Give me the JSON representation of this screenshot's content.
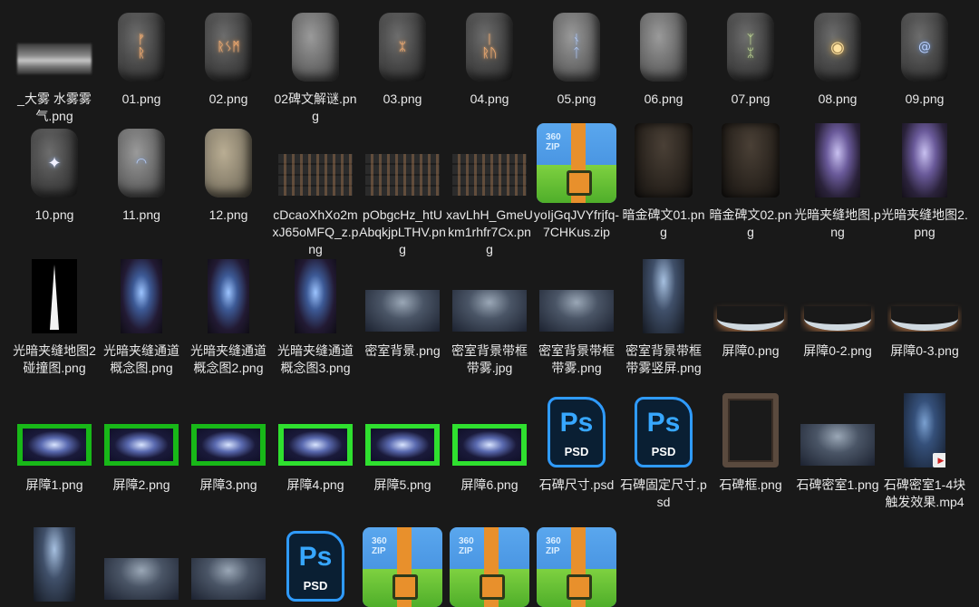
{
  "files": [
    {
      "name": "_大雾 水雾雾气.png",
      "thumb": "fog"
    },
    {
      "name": "01.png",
      "thumb": "stone",
      "glyph": "ᚠ\nᚱ",
      "tone": "orange"
    },
    {
      "name": "02.png",
      "thumb": "stone",
      "glyph": "ᚱᛊᛗ",
      "tone": "orange"
    },
    {
      "name": "02碑文解谜.png",
      "thumb": "stone-light",
      "glyph": ""
    },
    {
      "name": "03.png",
      "thumb": "stone",
      "glyph": "ᛯ",
      "tone": "orange"
    },
    {
      "name": "04.png",
      "thumb": "stone",
      "glyph": "ᛁ\nᚱᚢ",
      "tone": "orange"
    },
    {
      "name": "05.png",
      "thumb": "stone-light",
      "glyph": "ᚾ\nᛏ",
      "tone": "blue"
    },
    {
      "name": "06.png",
      "thumb": "stone-light",
      "glyph": "",
      "tone": "blue"
    },
    {
      "name": "07.png",
      "thumb": "stone",
      "glyph": "ᛉ\nᛯ",
      "tone": "green"
    },
    {
      "name": "08.png",
      "thumb": "stone",
      "glyph": "◉",
      "tone": "gold"
    },
    {
      "name": "09.png",
      "thumb": "stone",
      "glyph": "@",
      "tone": "blue"
    },
    {
      "name": "10.png",
      "thumb": "stone",
      "glyph": "✦",
      "tone": "white"
    },
    {
      "name": "11.png",
      "thumb": "stone-light",
      "glyph": "◠",
      "tone": "blue"
    },
    {
      "name": "12.png",
      "thumb": "stone-moss",
      "glyph": ""
    },
    {
      "name": "cDcaoXhXo2mxJ65oMFQ_z.png",
      "thumb": "sheet"
    },
    {
      "name": "pObgcHz_htUAbqkjpLTHV.png",
      "thumb": "sheet"
    },
    {
      "name": "xavLhH_GmeUkm1rhfr7Cx.png",
      "thumb": "sheet"
    },
    {
      "name": "yoIjGqJVYfrjfq-7CHKus.zip",
      "thumb": "zip"
    },
    {
      "name": "暗金碑文01.png",
      "thumb": "dark-tablet"
    },
    {
      "name": "暗金碑文02.png",
      "thumb": "dark-tablet"
    },
    {
      "name": "光暗夹缝地图.png",
      "thumb": "tower"
    },
    {
      "name": "光暗夹缝地图2.png",
      "thumb": "tower"
    },
    {
      "name": "光暗夹缝地图2碰撞图.png",
      "thumb": "spike"
    },
    {
      "name": "光暗夹缝通道概念图.png",
      "thumb": "concept"
    },
    {
      "name": "光暗夹缝通道概念图2.png",
      "thumb": "concept"
    },
    {
      "name": "光暗夹缝通道概念图3.png",
      "thumb": "concept"
    },
    {
      "name": "密室背景.png",
      "thumb": "room"
    },
    {
      "name": "密室背景带框带雾.jpg",
      "thumb": "room"
    },
    {
      "name": "密室背景带框带雾.png",
      "thumb": "room"
    },
    {
      "name": "密室背景带框带雾竖屏.png",
      "thumb": "room-v"
    },
    {
      "name": "屏障0.png",
      "thumb": "barrier"
    },
    {
      "name": "屏障0-2.png",
      "thumb": "barrier"
    },
    {
      "name": "屏障0-3.png",
      "thumb": "barrier"
    },
    {
      "name": "屏障1.png",
      "thumb": "green"
    },
    {
      "name": "屏障2.png",
      "thumb": "green"
    },
    {
      "name": "屏障3.png",
      "thumb": "green"
    },
    {
      "name": "屏障4.png",
      "thumb": "green-bright"
    },
    {
      "name": "屏障5.png",
      "thumb": "green-bright"
    },
    {
      "name": "屏障6.png",
      "thumb": "green-bright"
    },
    {
      "name": "石碑尺寸.psd",
      "thumb": "psd"
    },
    {
      "name": "石碑固定尺寸.psd",
      "thumb": "psd"
    },
    {
      "name": "石碑框.png",
      "thumb": "frame"
    },
    {
      "name": "石碑密室1.png",
      "thumb": "room"
    },
    {
      "name": "石碑密室1-4块触发效果.mp4",
      "thumb": "mp4"
    },
    {
      "name": "",
      "thumb": "room-v"
    },
    {
      "name": "",
      "thumb": "room"
    },
    {
      "name": "",
      "thumb": "room"
    },
    {
      "name": "",
      "thumb": "psd"
    },
    {
      "name": "",
      "thumb": "zip"
    },
    {
      "name": "",
      "thumb": "zip"
    },
    {
      "name": "",
      "thumb": "zip"
    }
  ],
  "icons": {
    "zip_tag_1": "360",
    "zip_tag_2": "ZIP",
    "psd_ps": "Ps",
    "psd_ext": "PSD"
  }
}
